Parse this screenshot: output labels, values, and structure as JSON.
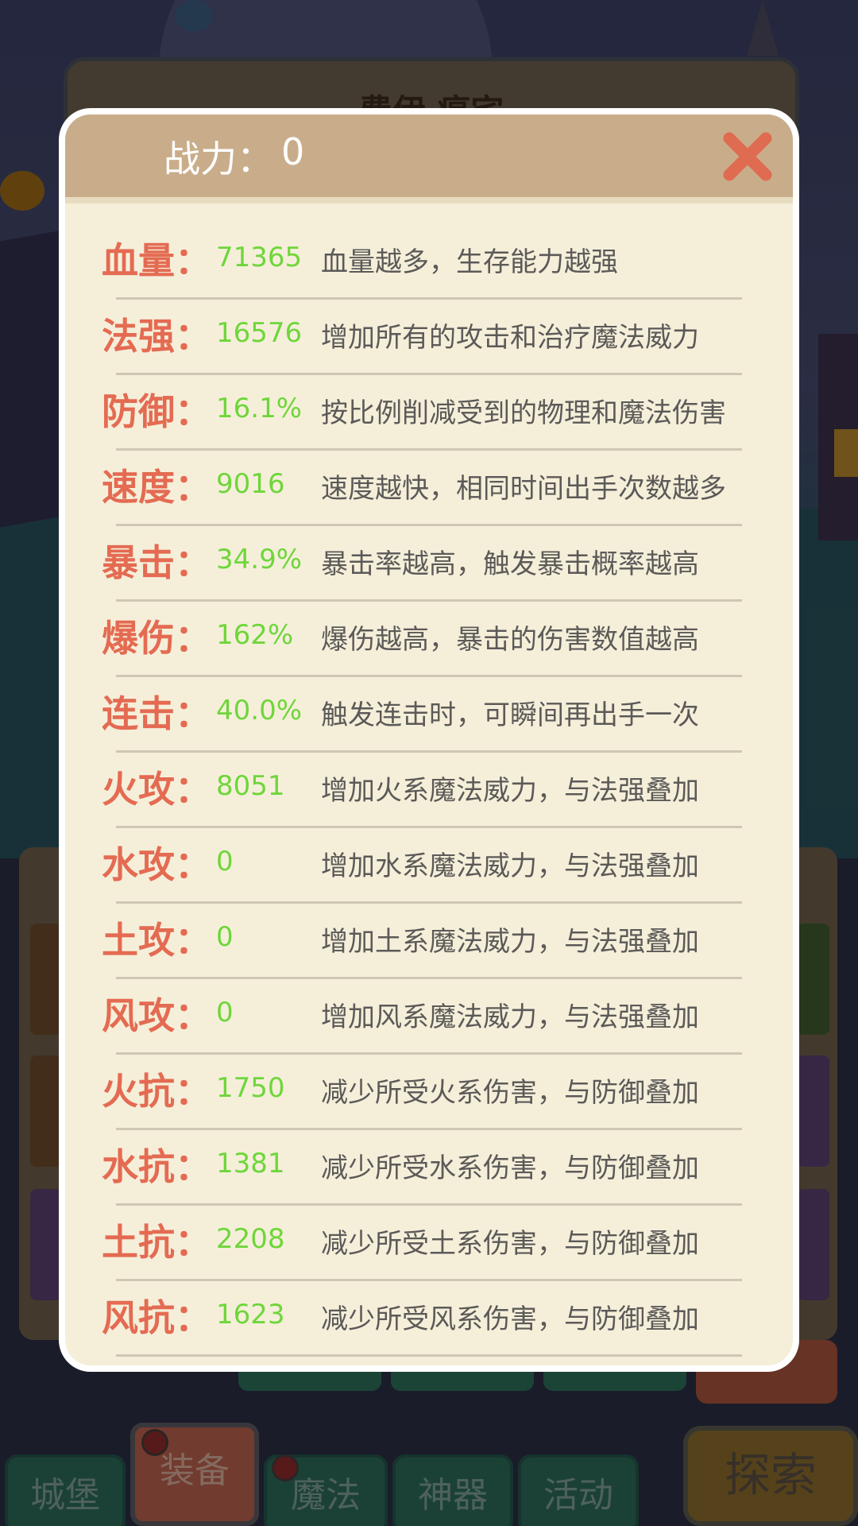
{
  "background": {
    "panel_title": "费伊 瘟宅",
    "nav": [
      {
        "label": "城堡",
        "active": false,
        "badge": false
      },
      {
        "label": "装备",
        "active": true,
        "badge": true
      },
      {
        "label": "魔法",
        "active": false,
        "badge": true
      },
      {
        "label": "神器",
        "active": false,
        "badge": false
      },
      {
        "label": "活动",
        "active": false,
        "badge": false
      }
    ],
    "explore_label": "探索"
  },
  "modal": {
    "power_label": "战力：",
    "power_value": "0",
    "close_icon": "close-x-icon",
    "colors": {
      "name": "#e46b52",
      "value": "#6fd63a",
      "desc": "#5c5a58",
      "header": "#c9ad8b"
    },
    "stats": [
      {
        "name": "血量：",
        "value": "71365",
        "desc": "血量越多，生存能力越强"
      },
      {
        "name": "法强：",
        "value": "16576",
        "desc": "增加所有的攻击和治疗魔法威力"
      },
      {
        "name": "防御：",
        "value": "16.1%",
        "desc": "按比例削减受到的物理和魔法伤害"
      },
      {
        "name": "速度：",
        "value": "9016",
        "desc": "速度越快，相同时间出手次数越多"
      },
      {
        "name": "暴击：",
        "value": "34.9%",
        "desc": "暴击率越高，触发暴击概率越高"
      },
      {
        "name": "爆伤：",
        "value": "162%",
        "desc": "爆伤越高，暴击的伤害数值越高"
      },
      {
        "name": "连击：",
        "value": "40.0%",
        "desc": "触发连击时，可瞬间再出手一次"
      },
      {
        "name": "火攻：",
        "value": "8051",
        "desc": "增加火系魔法威力，与法强叠加"
      },
      {
        "name": "水攻：",
        "value": "0",
        "desc": "增加水系魔法威力，与法强叠加"
      },
      {
        "name": "土攻：",
        "value": "0",
        "desc": "增加土系魔法威力，与法强叠加"
      },
      {
        "name": "风攻：",
        "value": "0",
        "desc": "增加风系魔法威力，与法强叠加"
      },
      {
        "name": "火抗：",
        "value": "1750",
        "desc": "减少所受火系伤害，与防御叠加"
      },
      {
        "name": "水抗：",
        "value": "1381",
        "desc": "减少所受水系伤害，与防御叠加"
      },
      {
        "name": "土抗：",
        "value": "2208",
        "desc": "减少所受土系伤害，与防御叠加"
      },
      {
        "name": "风抗：",
        "value": "1623",
        "desc": "减少所受风系伤害，与防御叠加"
      }
    ]
  }
}
